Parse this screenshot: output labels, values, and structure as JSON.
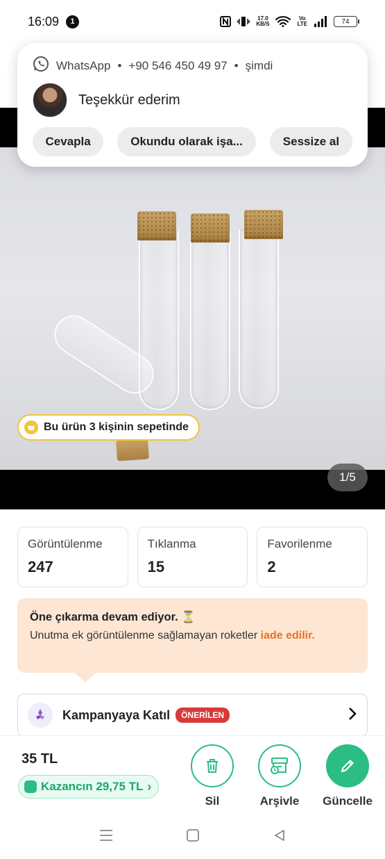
{
  "status_bar": {
    "time": "16:09",
    "notification_count": "1",
    "net_speed_value": "17.0",
    "net_speed_unit": "KB/S",
    "volte_top": "Vo",
    "volte_bottom": "LTE",
    "battery": "74"
  },
  "notification": {
    "app": "WhatsApp",
    "sender": "+90 546 450 49 97",
    "time": "şimdi",
    "message": "Teşekkür ederim",
    "actions": [
      "Cevapla",
      "Okundu olarak işa...",
      "Sessize al"
    ]
  },
  "product": {
    "basket_badge": "Bu ürün 3 kişinin sepetinde",
    "pager": "1/5"
  },
  "stats": [
    {
      "label": "Görüntülenme",
      "value": "247"
    },
    {
      "label": "Tıklanma",
      "value": "15"
    },
    {
      "label": "Favorilenme",
      "value": "2"
    }
  ],
  "promo": {
    "title": "Öne çıkarma devam ediyor. ⏳",
    "text": "Unutma ek görüntülenme sağlamayan roketler",
    "link": "iade edilir."
  },
  "campaign": {
    "label": "Kampanyaya Katıl",
    "badge": "ÖNERİLEN"
  },
  "bottom_bar": {
    "price": "35 TL",
    "earnings": "Kazancın 29,75 TL",
    "actions": {
      "delete": "Sil",
      "archive": "Arşivle",
      "update": "Güncelle"
    }
  },
  "colors": {
    "accent_green": "#2bbd83",
    "promo_bg": "#fde6d3",
    "promo_link": "#e8722a",
    "badge_red": "#d83a3a",
    "badge_yellow": "#f3c53a"
  }
}
